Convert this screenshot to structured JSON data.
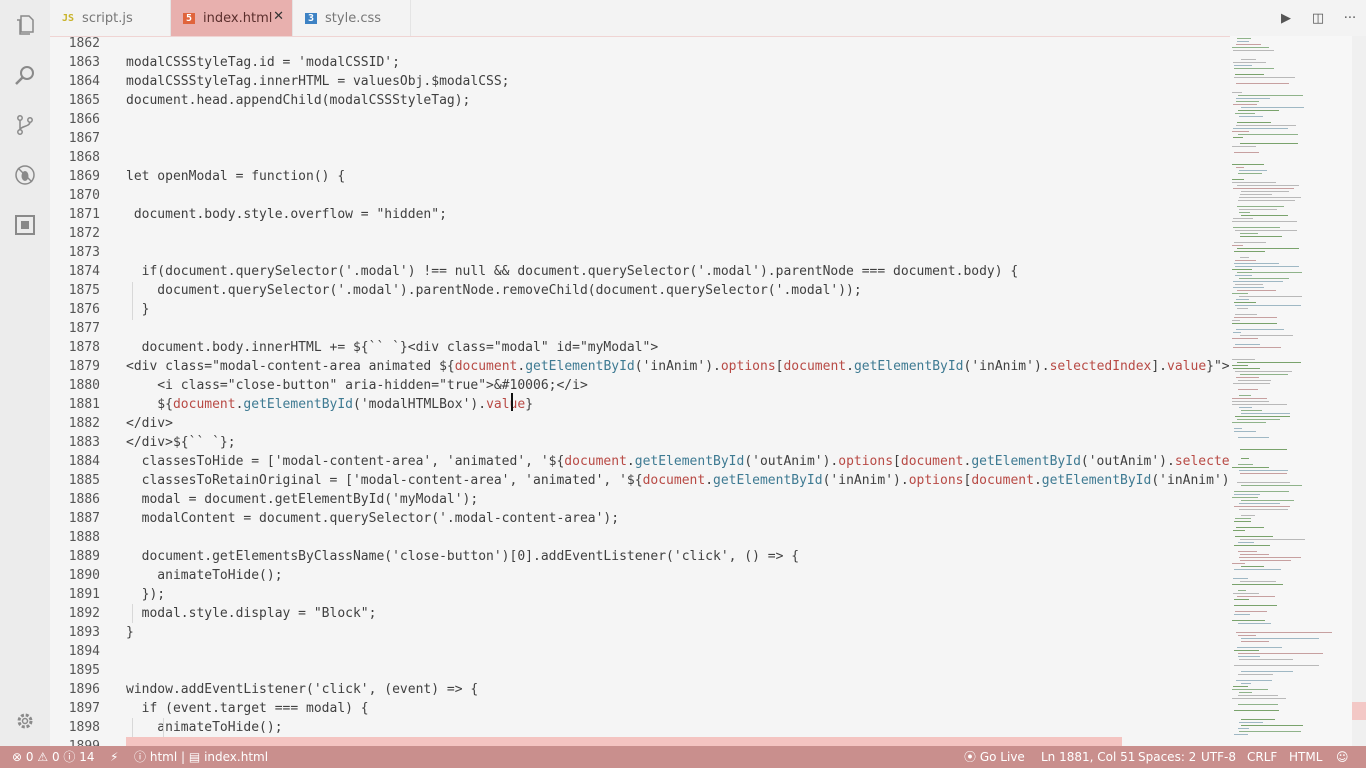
{
  "activity_bar": {
    "items": [
      "explorer-icon",
      "search-icon",
      "source-control-icon",
      "debug-icon",
      "extensions-icon"
    ],
    "bottom": "gear-icon"
  },
  "tabs": [
    {
      "icon": "JS",
      "label": "script.js",
      "active": false
    },
    {
      "icon": "5",
      "label": "index.html",
      "active": true
    },
    {
      "icon": "3",
      "label": "style.css",
      "active": false
    }
  ],
  "tab_actions": {
    "run": "▶",
    "split": "◫",
    "more": "···"
  },
  "editor": {
    "line_numbers": [
      "1862",
      "1863",
      "1864",
      "1865",
      "1866",
      "1867",
      "1868",
      "1869",
      "1870",
      "1871",
      "1872",
      "1873",
      "1874",
      "1875",
      "1876",
      "1877",
      "1878",
      "1879",
      "1880",
      "1881",
      "1882",
      "1883",
      "1884",
      "1885",
      "1886",
      "1887",
      "1888",
      "1889",
      "1890",
      "1891",
      "1892",
      "1893",
      "1894",
      "1895",
      "1896",
      "1897",
      "1898",
      "1899"
    ],
    "lines": [
      [],
      [
        {
          "t": "modalCSSStyleTag.id = 'modalCSSID';"
        }
      ],
      [
        {
          "t": "modalCSSStyleTag.innerHTML = valuesObj.$modalCSS;"
        }
      ],
      [
        {
          "t": "document.head.appendChild(modalCSSStyleTag);"
        }
      ],
      [],
      [],
      [],
      [
        {
          "t": "let openModal = function() {"
        }
      ],
      [],
      [
        {
          "t": " document.body.style.overflow = \"hidden\";"
        }
      ],
      [],
      [],
      [
        {
          "t": "  if(document.querySelector('.modal') !== null && document.querySelector('.modal').parentNode === document.body) {"
        }
      ],
      [
        {
          "t": "    document.querySelector('.modal').parentNode.removeChild(document.querySelector('.modal'));"
        }
      ],
      [
        {
          "t": "  }"
        }
      ],
      [],
      [
        {
          "t": "  document.body.innerHTML += ${`` `}<div class=\"modal\" id=\"myModal\">"
        }
      ],
      [
        {
          "t": "<div class=\"modal-content-area animated ${"
        },
        {
          "t": "document",
          "c": "p"
        },
        {
          "t": "."
        },
        {
          "t": "getElementById",
          "c": "f"
        },
        {
          "t": "('inAnim')."
        },
        {
          "t": "options",
          "c": "p"
        },
        {
          "t": "["
        },
        {
          "t": "document",
          "c": "p"
        },
        {
          "t": "."
        },
        {
          "t": "getElementById",
          "c": "f"
        },
        {
          "t": "('inAnim')."
        },
        {
          "t": "selectedIndex",
          "c": "p"
        },
        {
          "t": "]."
        },
        {
          "t": "value",
          "c": "p"
        },
        {
          "t": "}\">"
        }
      ],
      [
        {
          "t": "    <i class=\"close-button\" aria-hidden=\"true\">&#10006;</i>"
        }
      ],
      [
        {
          "t": "    ${"
        },
        {
          "t": "document",
          "c": "p"
        },
        {
          "t": "."
        },
        {
          "t": "getElementById",
          "c": "f"
        },
        {
          "t": "('modalHTMLBox')."
        },
        {
          "t": "value",
          "c": "p"
        },
        {
          "t": "}"
        }
      ],
      [
        {
          "t": "</div>"
        }
      ],
      [
        {
          "t": "</div>${`` `};"
        }
      ],
      [
        {
          "t": "  classesToHide = ['modal-content-area', 'animated', '${"
        },
        {
          "t": "document",
          "c": "p"
        },
        {
          "t": "."
        },
        {
          "t": "getElementById",
          "c": "f"
        },
        {
          "t": "('outAnim')."
        },
        {
          "t": "options",
          "c": "p"
        },
        {
          "t": "["
        },
        {
          "t": "document",
          "c": "p"
        },
        {
          "t": "."
        },
        {
          "t": "getElementById",
          "c": "f"
        },
        {
          "t": "('outAnim')."
        },
        {
          "t": "selectedIn",
          "c": "p"
        }
      ],
      [
        {
          "t": "  classesToRetainOriginal = ['modal-content-area', 'animated', '${"
        },
        {
          "t": "document",
          "c": "p"
        },
        {
          "t": "."
        },
        {
          "t": "getElementById",
          "c": "f"
        },
        {
          "t": "('inAnim')."
        },
        {
          "t": "options",
          "c": "p"
        },
        {
          "t": "["
        },
        {
          "t": "document",
          "c": "p"
        },
        {
          "t": "."
        },
        {
          "t": "getElementById",
          "c": "f"
        },
        {
          "t": "('inAnim')."
        },
        {
          "t": "se",
          "c": "p"
        }
      ],
      [
        {
          "t": "  modal = document.getElementById('myModal');"
        }
      ],
      [
        {
          "t": "  modalContent = document.querySelector('.modal-content-area');"
        }
      ],
      [],
      [
        {
          "t": "  document.getElementsByClassName('close-button')[0].addEventListener('click', () => {"
        }
      ],
      [
        {
          "t": "    animateToHide();"
        }
      ],
      [
        {
          "t": "  });"
        }
      ],
      [
        {
          "t": "  modal.style.display = \"Block\";"
        }
      ],
      [
        {
          "t": "}"
        }
      ],
      [],
      [],
      [
        {
          "t": "window.addEventListener('click', (event) => {"
        }
      ],
      [
        {
          "t": "  if (event.target === modal) {"
        }
      ],
      [
        {
          "t": "    animateToHide();"
        }
      ],
      []
    ]
  },
  "status_bar": {
    "errors": "0",
    "warnings": "0",
    "infos": "14",
    "html_label": "html",
    "file": "index.html",
    "go_live": "Go Live",
    "position": "Ln 1881, Col 51",
    "spaces": "Spaces: 2",
    "encoding": "UTF-8",
    "eol": "CRLF",
    "language": "HTML"
  },
  "colors": {
    "accent": "#c98f8d",
    "active_tab": "#e8b0ae",
    "property": "#b84a45",
    "function": "#3e7a92"
  }
}
